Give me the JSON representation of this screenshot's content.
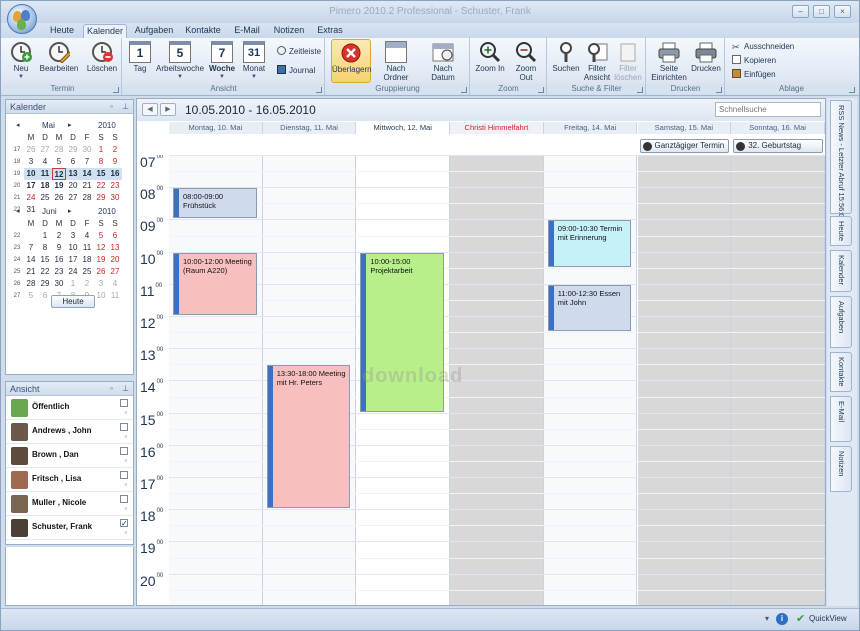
{
  "window": {
    "title": "Pimero 2010.2 Professional - Schuster, Frank",
    "btn_min": "–",
    "btn_max": "□",
    "btn_close": "×"
  },
  "tabs": [
    "Heute",
    "Kalender",
    "Aufgaben",
    "Kontakte",
    "E-Mail",
    "Notizen",
    "Extras"
  ],
  "ribbon": {
    "termin": {
      "label": "Termin",
      "neu": "Neu",
      "bearbeiten": "Bearbeiten",
      "loeschen": "Löschen"
    },
    "ansicht": {
      "label": "Ansicht",
      "tag": "Tag",
      "tag_num": "1",
      "arbeitswoche": "Arbeitswoche",
      "aw_num": "5",
      "woche": "Woche",
      "woche_num": "7",
      "monat": "Monat",
      "monat_num": "31",
      "zeitleiste": "Zeitleiste",
      "journal": "Journal"
    },
    "gruppierung": {
      "label": "Gruppierung",
      "ueberlagern": "Überlagern",
      "nach_ordner": "Nach Ordner",
      "nach_datum": "Nach Datum"
    },
    "zoom": {
      "label": "Zoom",
      "zoom_in": "Zoom In",
      "zoom_out": "Zoom Out"
    },
    "suche": {
      "label": "Suche & Filter",
      "suchen": "Suchen",
      "filter_ansicht": "Filter Ansicht",
      "filter_loeschen": "Filter löschen"
    },
    "drucken": {
      "label": "Drucken",
      "seite": "Seite Einrichten",
      "drucken": "Drucken"
    },
    "ablage": {
      "label": "Ablage",
      "ausschneiden": "Ausschneiden",
      "kopieren": "Kopieren",
      "einfuegen": "Einfügen"
    }
  },
  "kalender_panel": {
    "title": "Kalender",
    "today_button": "Heute",
    "months": [
      {
        "name": "Mai",
        "year": "2010",
        "dow": [
          "M",
          "D",
          "M",
          "D",
          "F",
          "S",
          "S"
        ],
        "weeks": [
          {
            "wk": "17",
            "days": [
              {
                "d": "26",
                "c": "gray"
              },
              {
                "d": "27",
                "c": "gray"
              },
              {
                "d": "28",
                "c": "gray"
              },
              {
                "d": "29",
                "c": "gray"
              },
              {
                "d": "30",
                "c": "gray"
              },
              {
                "d": "1",
                "c": "red"
              },
              {
                "d": "2",
                "c": "red"
              }
            ]
          },
          {
            "wk": "18",
            "days": [
              {
                "d": "3"
              },
              {
                "d": "4"
              },
              {
                "d": "5"
              },
              {
                "d": "6"
              },
              {
                "d": "7"
              },
              {
                "d": "8",
                "c": "red"
              },
              {
                "d": "9",
                "c": "red"
              }
            ]
          },
          {
            "wk": "19",
            "days": [
              {
                "d": "10",
                "c": "bold sel"
              },
              {
                "d": "11",
                "c": "bold sel"
              },
              {
                "d": "12",
                "c": "bold sel today"
              },
              {
                "d": "13",
                "c": "bold sel"
              },
              {
                "d": "14",
                "c": "bold sel"
              },
              {
                "d": "15",
                "c": "bold sel"
              },
              {
                "d": "16",
                "c": "bold sel"
              }
            ]
          },
          {
            "wk": "20",
            "days": [
              {
                "d": "17",
                "c": "bold"
              },
              {
                "d": "18",
                "c": "bold"
              },
              {
                "d": "19",
                "c": "bold"
              },
              {
                "d": "20"
              },
              {
                "d": "21"
              },
              {
                "d": "22",
                "c": "red"
              },
              {
                "d": "23",
                "c": "red"
              }
            ]
          },
          {
            "wk": "21",
            "days": [
              {
                "d": "24",
                "c": "red"
              },
              {
                "d": "25"
              },
              {
                "d": "26"
              },
              {
                "d": "27"
              },
              {
                "d": "28"
              },
              {
                "d": "29",
                "c": "red"
              },
              {
                "d": "30",
                "c": "red"
              }
            ]
          },
          {
            "wk": "22",
            "days": [
              {
                "d": "31"
              },
              {
                "d": ""
              },
              {
                "d": ""
              },
              {
                "d": ""
              },
              {
                "d": ""
              },
              {
                "d": ""
              },
              {
                "d": ""
              }
            ]
          }
        ]
      },
      {
        "name": "Juni",
        "year": "2010",
        "dow": [
          "M",
          "D",
          "M",
          "D",
          "F",
          "S",
          "S"
        ],
        "weeks": [
          {
            "wk": "22",
            "days": [
              {
                "d": ""
              },
              {
                "d": "1"
              },
              {
                "d": "2"
              },
              {
                "d": "3"
              },
              {
                "d": "4"
              },
              {
                "d": "5",
                "c": "red"
              },
              {
                "d": "6",
                "c": "red"
              }
            ]
          },
          {
            "wk": "23",
            "days": [
              {
                "d": "7"
              },
              {
                "d": "8"
              },
              {
                "d": "9"
              },
              {
                "d": "10"
              },
              {
                "d": "11"
              },
              {
                "d": "12",
                "c": "red"
              },
              {
                "d": "13",
                "c": "red"
              }
            ]
          },
          {
            "wk": "24",
            "days": [
              {
                "d": "14"
              },
              {
                "d": "15"
              },
              {
                "d": "16"
              },
              {
                "d": "17"
              },
              {
                "d": "18"
              },
              {
                "d": "19",
                "c": "red"
              },
              {
                "d": "20",
                "c": "red"
              }
            ]
          },
          {
            "wk": "25",
            "days": [
              {
                "d": "21"
              },
              {
                "d": "22"
              },
              {
                "d": "23"
              },
              {
                "d": "24"
              },
              {
                "d": "25"
              },
              {
                "d": "26",
                "c": "red"
              },
              {
                "d": "27",
                "c": "red"
              }
            ]
          },
          {
            "wk": "26",
            "days": [
              {
                "d": "28"
              },
              {
                "d": "29"
              },
              {
                "d": "30"
              },
              {
                "d": "1",
                "c": "gray"
              },
              {
                "d": "2",
                "c": "gray"
              },
              {
                "d": "3",
                "c": "gray"
              },
              {
                "d": "4",
                "c": "gray"
              }
            ]
          },
          {
            "wk": "27",
            "days": [
              {
                "d": "5",
                "c": "gray"
              },
              {
                "d": "6",
                "c": "gray"
              },
              {
                "d": "7",
                "c": "gray"
              },
              {
                "d": "8",
                "c": "gray"
              },
              {
                "d": "9",
                "c": "gray"
              },
              {
                "d": "10",
                "c": "gray"
              },
              {
                "d": "11",
                "c": "gray"
              }
            ]
          }
        ]
      }
    ]
  },
  "ansicht_panel": {
    "title": "Ansicht",
    "people": [
      {
        "name": "Öffentlich",
        "checked": false,
        "color": "#6aa84f"
      },
      {
        "name": "Andrews , John",
        "checked": false,
        "color": "#6b5848"
      },
      {
        "name": "Brown , Dan",
        "checked": false,
        "color": "#5d4b3c"
      },
      {
        "name": "Fritsch , Lisa",
        "checked": false,
        "color": "#a06a50"
      },
      {
        "name": "Muller , Nicole",
        "checked": false,
        "color": "#7a6650"
      },
      {
        "name": "Schuster, Frank",
        "checked": true,
        "color": "#4a4036"
      }
    ]
  },
  "calendar": {
    "range": "10.05.2010 - 16.05.2010",
    "search_placeholder": "Schnellsuche",
    "nav_prev": "◀",
    "nav_next": "▶",
    "days": [
      {
        "label": "Montag, 10. Mai",
        "type": "normal"
      },
      {
        "label": "Dienstag, 11. Mai",
        "type": "normal"
      },
      {
        "label": "Mittwoch, 12. Mai",
        "type": "current"
      },
      {
        "label": "Christi Himmelfahrt",
        "type": "holiday"
      },
      {
        "label": "Freitag, 14. Mai",
        "type": "normal"
      },
      {
        "label": "Samstag, 15. Mai",
        "type": "weekend"
      },
      {
        "label": "Sonntag, 16. Mai",
        "type": "weekend"
      }
    ],
    "hours": [
      "07",
      "08",
      "09",
      "10",
      "11",
      "12",
      "13",
      "14",
      "15",
      "16",
      "17",
      "18",
      "19",
      "20"
    ],
    "hour_minutes": "00",
    "allday": [
      {
        "day": 5,
        "text": "Ganztägiger Termin"
      },
      {
        "day": 6,
        "text": "32. Geburtstag"
      }
    ],
    "appointments": [
      {
        "day": 0,
        "start": 8,
        "end": 9,
        "text": "08:00-09:00 Frühstück",
        "color": "#cfdbed"
      },
      {
        "day": 0,
        "start": 10,
        "end": 12,
        "text": "10:00-12:00 Meeting (Raum A220)",
        "color": "#f7bfbf"
      },
      {
        "day": 1,
        "start": 13.5,
        "end": 18,
        "text": "13:30-18:00 Meeting mit Hr. Peters",
        "color": "#f7bfbf"
      },
      {
        "day": 2,
        "start": 10,
        "end": 15,
        "text": "10:00-15:00 Projektarbeit",
        "color": "#b8ef8a"
      },
      {
        "day": 4,
        "start": 9,
        "end": 10.5,
        "text": "09:00-10:30 Termin mit Erinnerung",
        "color": "#c6f1f8"
      },
      {
        "day": 4,
        "start": 11,
        "end": 12.5,
        "text": "11:00-12:30 Essen mit John",
        "color": "#cfdbed"
      }
    ],
    "watermark": "download"
  },
  "side_tabs": [
    "RSS News - Letzter Abruf 15:56:08",
    "Heute",
    "Kalender",
    "Aufgaben",
    "Kontakte",
    "E-Mail",
    "Notizen"
  ],
  "status": {
    "quickview": "QuickView"
  }
}
